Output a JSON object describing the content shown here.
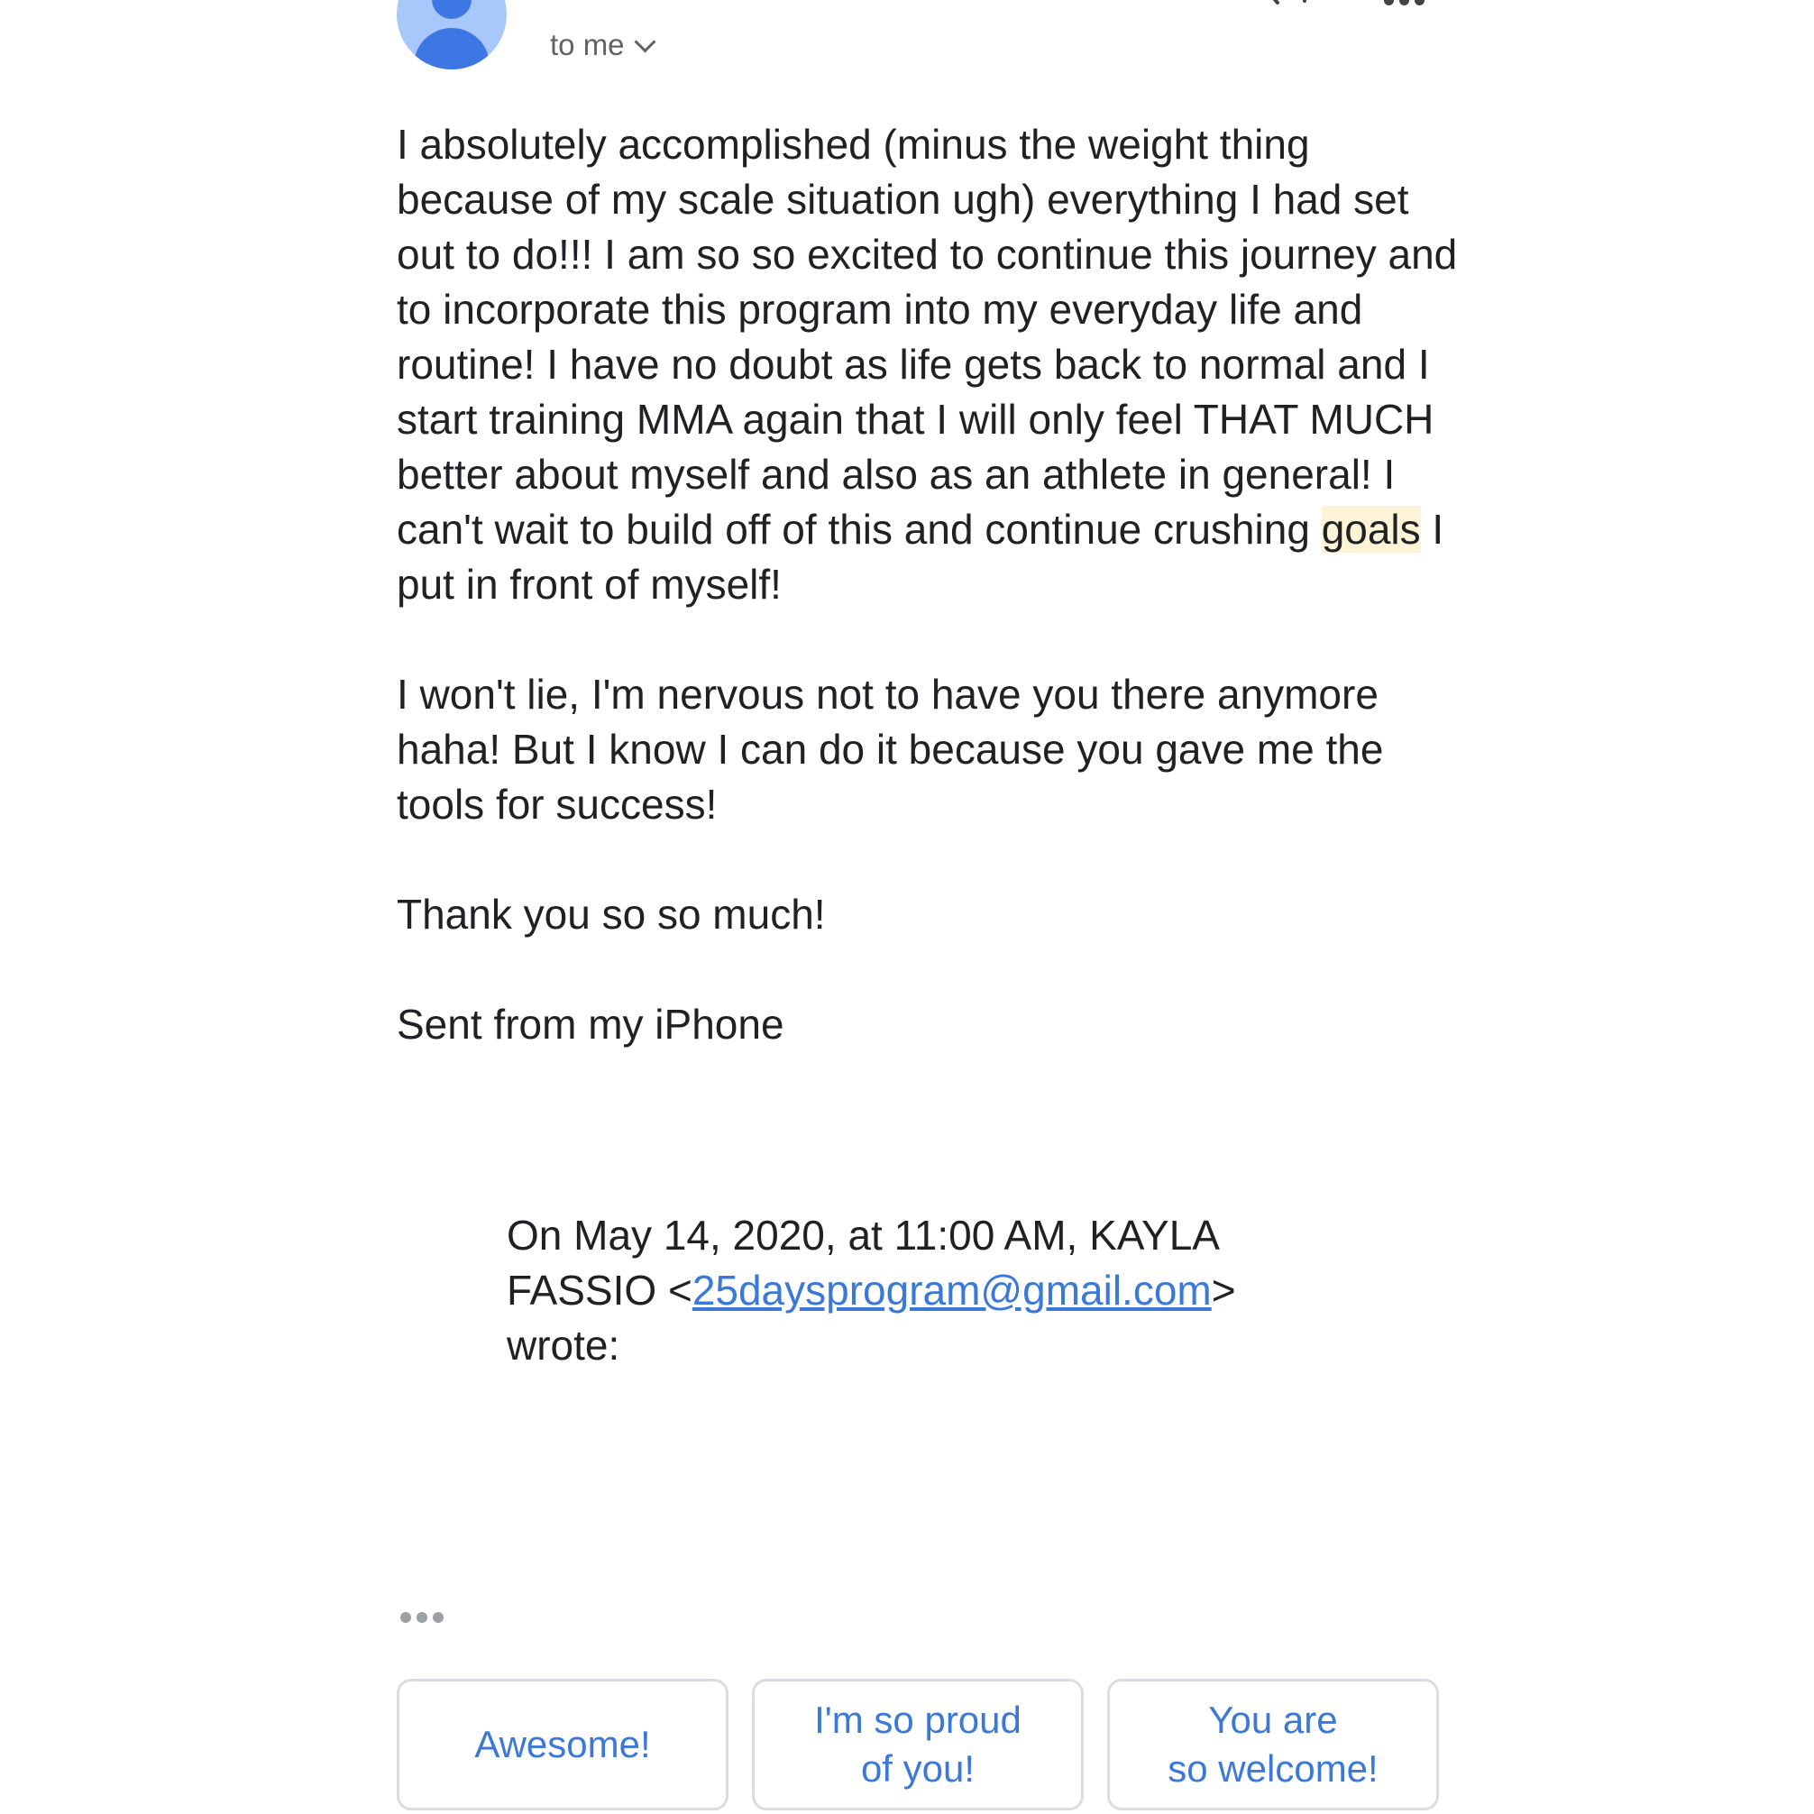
{
  "header": {
    "recipient_label": "to me"
  },
  "body": {
    "paragraph1_before": "I absolutely accomplished (minus the weight thing because of my scale situation ugh) everything I had set out to do!!! I am so so excited to continue this journey and to incorporate this program into my everyday life and routine! I have no doubt as life gets back to normal and I start training MMA again that I will only feel THAT MUCH better about myself and also as an athlete in general! I can't wait to build off of this and continue crushing ",
    "paragraph1_highlight": "goals",
    "paragraph1_after": " I put in front of myself!",
    "paragraph2": "I won't lie, I'm nervous not to have you there anymore haha! But I know I can do it because you gave me the tools for success!",
    "paragraph3": "Thank you so so much!",
    "signature": "Sent from my iPhone"
  },
  "quote": {
    "intro": "On May 14, 2020, at 11:00 AM, KAYLA FASSIO <",
    "email": "25daysprogram@gmail.com",
    "outro": "> wrote:"
  },
  "smart_replies": [
    "Awesome!",
    "I'm so proud\nof you!",
    "You are\nso welcome!"
  ],
  "colors": {
    "link": "#3b78d8",
    "avatar_bg": "#a8c7fa",
    "avatar_fg": "#3d77e3",
    "highlight": "#fdf4d8"
  }
}
